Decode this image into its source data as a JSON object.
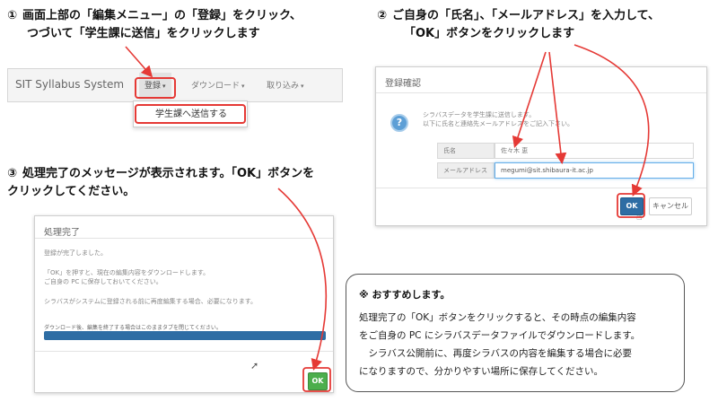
{
  "step1": {
    "number": "①",
    "line1": "画面上部の「編集メニュー」の「登録」をクリック、",
    "line2": "つづいて「学生課に送信」をクリックします",
    "navbar": {
      "brand": "SIT Syllabus System",
      "items": [
        {
          "label": "登録",
          "caret": "▾"
        },
        {
          "label": "ダウンロード",
          "caret": "▾"
        },
        {
          "label": "取り込み",
          "caret": "▾"
        }
      ],
      "dropdown_item": "学生課へ送信する"
    }
  },
  "step2": {
    "number": "②",
    "line1": "ご自身の「氏名」、「メールアドレス」を入力して、",
    "line2": "「OK」ボタンをクリックします",
    "dialog": {
      "title": "登録確認",
      "icon": "question-icon",
      "message_line1": "シラバスデータを学生課に送信します。",
      "message_line2": "以下に氏名と連絡先メールアドレスをご記入下さい。",
      "name_label": "氏名",
      "name_value": "佐々木 恵",
      "email_label": "メールアドレス",
      "email_value": "megumi@sit.shibaura-it.ac.jp",
      "ok_label": "OK",
      "cancel_label": "キャンセル"
    }
  },
  "step3": {
    "number": "③",
    "line1": "処理完了のメッセージが表示されます。「OK」ボタンを",
    "line2": "クリックしてください。",
    "dialog": {
      "title": "処理完了",
      "text1": "登録が完了しました。",
      "text2": "「OK」を押すと、現在の編集内容をダウンロードします。",
      "text3": "ご自身の PC に保存しておいてください。",
      "text4": "シラバスがシステムに登録される前に再度編集する場合、必要になります。",
      "progress_label": "ダウンロード後、編集を終了する場合はこのままタブを閉じてください。",
      "progress_fraction": 1.0,
      "ok_label": "OK"
    }
  },
  "note": {
    "heading": "※ おすすめします。",
    "line1": "処理完了の「OK」ボタンをクリックすると、その時点の編集内容",
    "line2": "をご自身の PC にシラバスデータファイルでダウンロードします。",
    "line3": "　シラバス公開前に、再度シラバスの内容を編集する場合に必要",
    "line4": "になりますので、分かりやすい場所に保存してください。"
  },
  "colors": {
    "annotation_red": "#e53935",
    "primary_blue": "#2e6da4",
    "success_green": "#4cae4c"
  }
}
